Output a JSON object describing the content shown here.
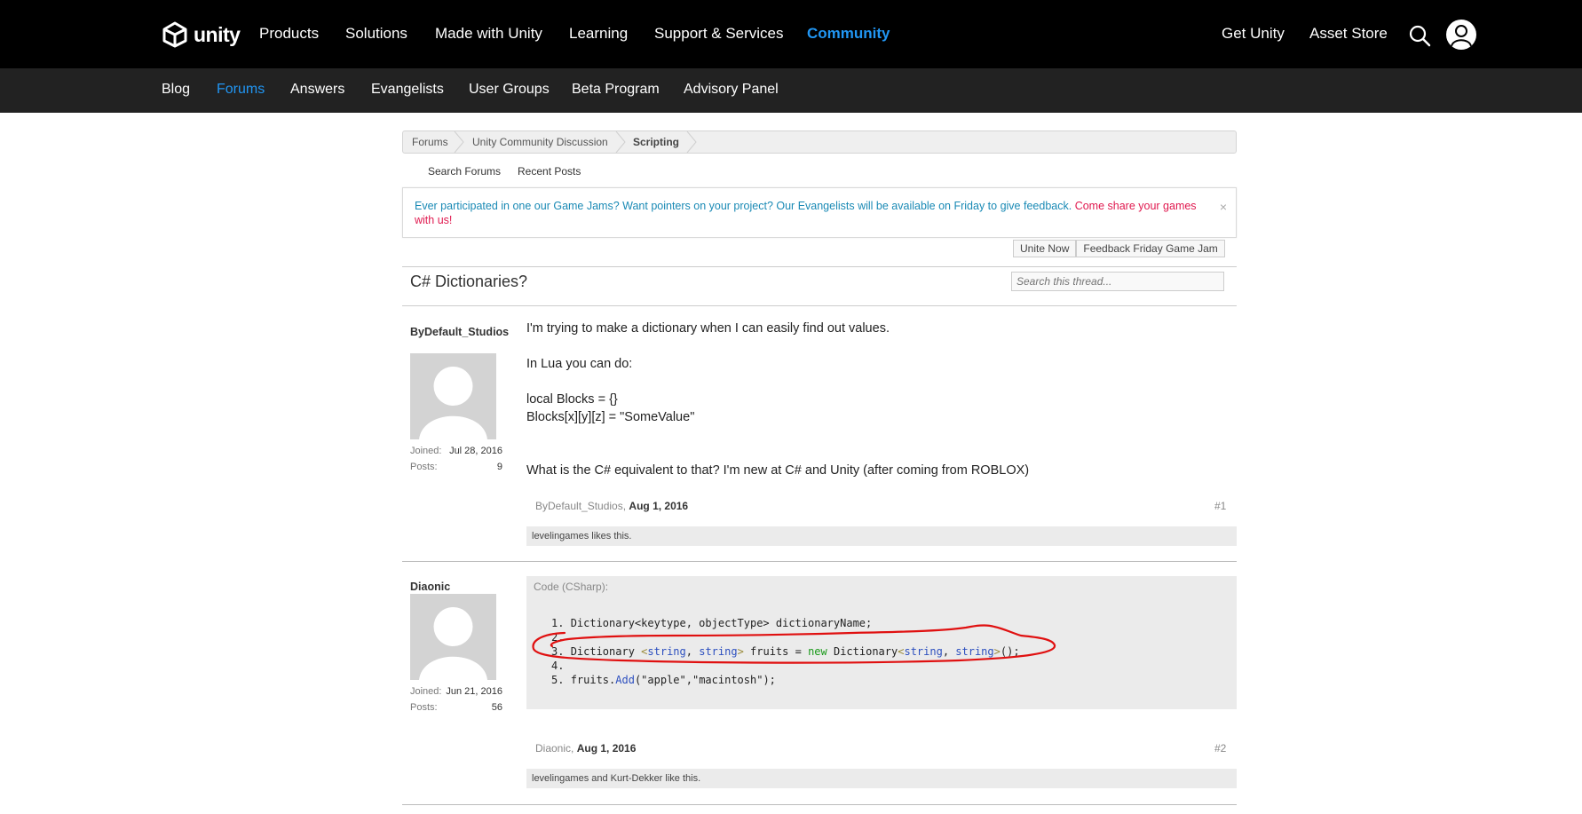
{
  "topnav": {
    "logo_text": "unity",
    "items": [
      "Products",
      "Solutions",
      "Made with Unity",
      "Learning",
      "Support & Services",
      "Community"
    ],
    "right_items": [
      "Get Unity",
      "Asset Store"
    ]
  },
  "subnav": {
    "items": [
      "Blog",
      "Forums",
      "Answers",
      "Evangelists",
      "User Groups",
      "Beta Program",
      "Advisory Panel"
    ]
  },
  "breadcrumb": [
    "Forums",
    "Unity Community Discussion",
    "Scripting"
  ],
  "forum_links": [
    "Search Forums",
    "Recent Posts"
  ],
  "notice": {
    "text": "Ever participated in one our Game Jams? Want pointers on your project? Our Evangelists will be available on Friday to give feedback.",
    "link": "Come share your games with us!",
    "close": "×"
  },
  "nav_tabs": [
    "Unite Now",
    "Feedback Friday Game Jam"
  ],
  "thread": {
    "title": "C# Dictionaries?",
    "search_placeholder": "Search this thread..."
  },
  "posts": [
    {
      "username": "ByDefault_Studios",
      "joined_label": "Joined:",
      "joined": "Jul 28, 2016",
      "posts_label": "Posts:",
      "posts": "9",
      "lines": [
        "I'm trying to make a dictionary when I can easily find out values.",
        "In Lua you can do:",
        "local Blocks = {}",
        "Blocks[x][y][z] = \"SomeValue\"",
        "What is the C# equivalent to that? I'm new at C# and Unity (after coming from ROBLOX)"
      ],
      "footer_user": "ByDefault_Studios,",
      "footer_date": "Aug 1, 2016",
      "number": "#1",
      "likes": "levelingames likes this."
    },
    {
      "username": "Diaonic",
      "joined_label": "Joined:",
      "joined": "Jun 21, 2016",
      "posts_label": "Posts:",
      "posts": "56",
      "code_header": "Code (CSharp):",
      "footer_user": "Diaonic,",
      "footer_date": "Aug 1, 2016",
      "number": "#2",
      "likes": "levelingames and Kurt-Dekker like this."
    }
  ],
  "code": {
    "line_numbers": [
      "1.",
      "2.",
      "3.",
      "4.",
      "5."
    ],
    "l1": "Dictionary<keytype, objectType> dictionaryName;",
    "l3_a": "Dictionary ",
    "l3_b": "<",
    "l3_c": "string",
    "l3_d": ", ",
    "l3_e": "string",
    "l3_f": ">",
    "l3_g": " fruits = ",
    "l3_h": "new",
    "l3_i": " Dictionary",
    "l3_j": "<",
    "l3_k": "string",
    "l3_l": ", ",
    "l3_m": "string",
    "l3_n": ">",
    "l3_o": "();",
    "l5_a": "fruits.",
    "l5_b": "Add",
    "l5_c": "(\"apple\",\"macintosh\");"
  },
  "colors": {
    "topnav_bg": "#000000",
    "subnav_bg": "#222222",
    "accent": "#2196f3",
    "notice_text": "#1a8ab5",
    "notice_link": "#e0194f",
    "annotation": "#e01010"
  },
  "icons": [
    "unity-logo-icon",
    "search-icon",
    "user-account-icon",
    "close-icon",
    "default-avatar-icon"
  ]
}
